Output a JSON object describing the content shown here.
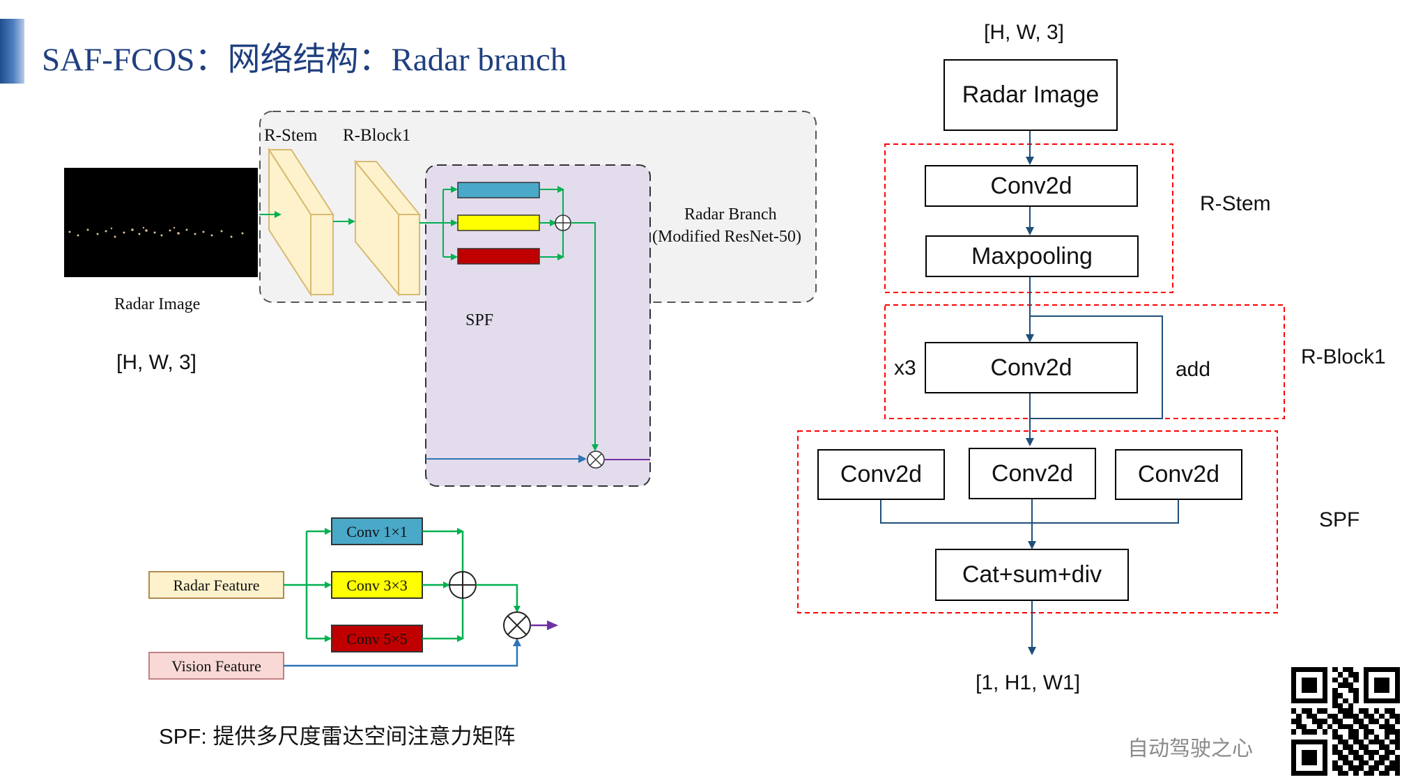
{
  "header": {
    "title": "SAF-FCOS：网络结构：Radar branch"
  },
  "left_diagram": {
    "radar_image_label": "Radar Image",
    "input_shape": "[H, W, 3]",
    "r_stem_label": "R-Stem",
    "r_block1_label": "R-Block1",
    "spf_label": "SPF",
    "branch_label_line1": "Radar Branch",
    "branch_label_line2": "(Modified ResNet-50)"
  },
  "spf_module": {
    "radar_feature": "Radar Feature",
    "vision_feature": "Vision Feature",
    "conv1": "Conv 1×1",
    "conv3": "Conv 3×3",
    "conv5": "Conv 5×5",
    "caption": "SPF: 提供多尺度雷达空间注意力矩阵",
    "colors": {
      "conv1": "#4aa8c8",
      "conv3": "#ffff00",
      "conv5": "#c00000",
      "radar_feature": "#fdf2cc",
      "vision_feature": "#f8d9d6",
      "green_arrow": "#00b050",
      "blue_arrow": "#2e75b6",
      "purple_arrow": "#7030a0"
    }
  },
  "right_flow": {
    "input_shape": "[H, W, 3]",
    "radar_image": "Radar Image",
    "stem_conv": "Conv2d",
    "maxpool": "Maxpooling",
    "r_stem": "R-Stem",
    "repeat": "x3",
    "block_conv": "Conv2d",
    "add": "add",
    "r_block1": "R-Block1",
    "spf_conv_a": "Conv2d",
    "spf_conv_b": "Conv2d",
    "spf_conv_c": "Conv2d",
    "cat": "Cat+sum+div",
    "spf": "SPF",
    "output_shape": "[1, H1, W1]"
  },
  "footer": {
    "watermark": "自动驾驶之心",
    "qr_icon": "qr-code-icon"
  }
}
